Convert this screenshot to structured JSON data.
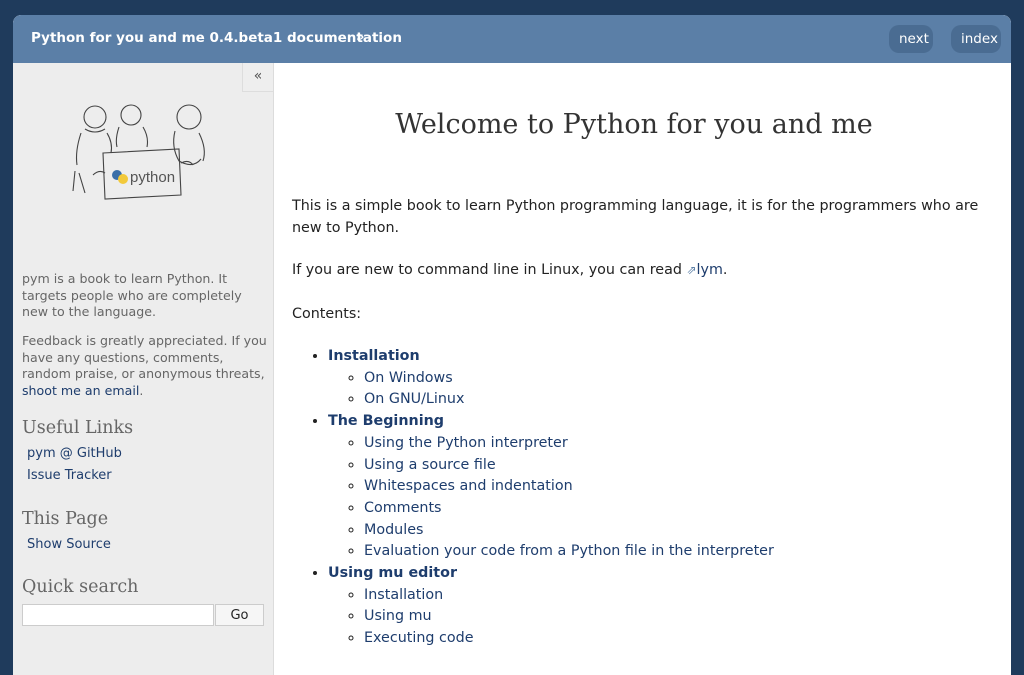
{
  "header": {
    "breadcrumb": "Python for you and me 0.4.beta1 documentation",
    "breadcrumb_sep": "»",
    "next_label": "next",
    "index_label": "index"
  },
  "sidebar": {
    "collapse_label": "«",
    "logo_text": "python",
    "intro": "pym is a book to learn Python. It targets people who are completely new to the language.",
    "feedback_text": "Feedback is greatly appreciated. If you have any questions, comments, random praise, or anonymous threats, ",
    "feedback_link": "shoot me an email",
    "feedback_end": ".",
    "useful_links_heading": "Useful Links",
    "useful_links": [
      "pym @ GitHub",
      "Issue Tracker"
    ],
    "this_page_heading": "This Page",
    "show_source": "Show Source",
    "quick_search_heading": "Quick search",
    "search_value": "",
    "go_label": "Go"
  },
  "main": {
    "title": "Welcome to Python for you and me",
    "intro": "This is a simple book to learn Python programming language, it is for the programmers who are new to Python.",
    "cli_text": "If you are new to command line in Linux, you can read ",
    "cli_link": "lym",
    "cli_end": ".",
    "contents_label": "Contents:",
    "toc": [
      {
        "title": "Installation",
        "items": [
          "On Windows",
          "On GNU/Linux"
        ]
      },
      {
        "title": "The Beginning",
        "items": [
          "Using the Python interpreter",
          "Using a source file",
          "Whitespaces and indentation",
          "Comments",
          "Modules",
          "Evaluation your code from a Python file in the interpreter"
        ]
      },
      {
        "title": "Using mu editor",
        "items": [
          "Installation",
          "Using mu",
          "Executing code"
        ]
      }
    ]
  },
  "colors": {
    "background": "#1f3b5c",
    "header": "#5b7fa7",
    "link": "#1e3d6d",
    "sidebar": "#ededed"
  }
}
